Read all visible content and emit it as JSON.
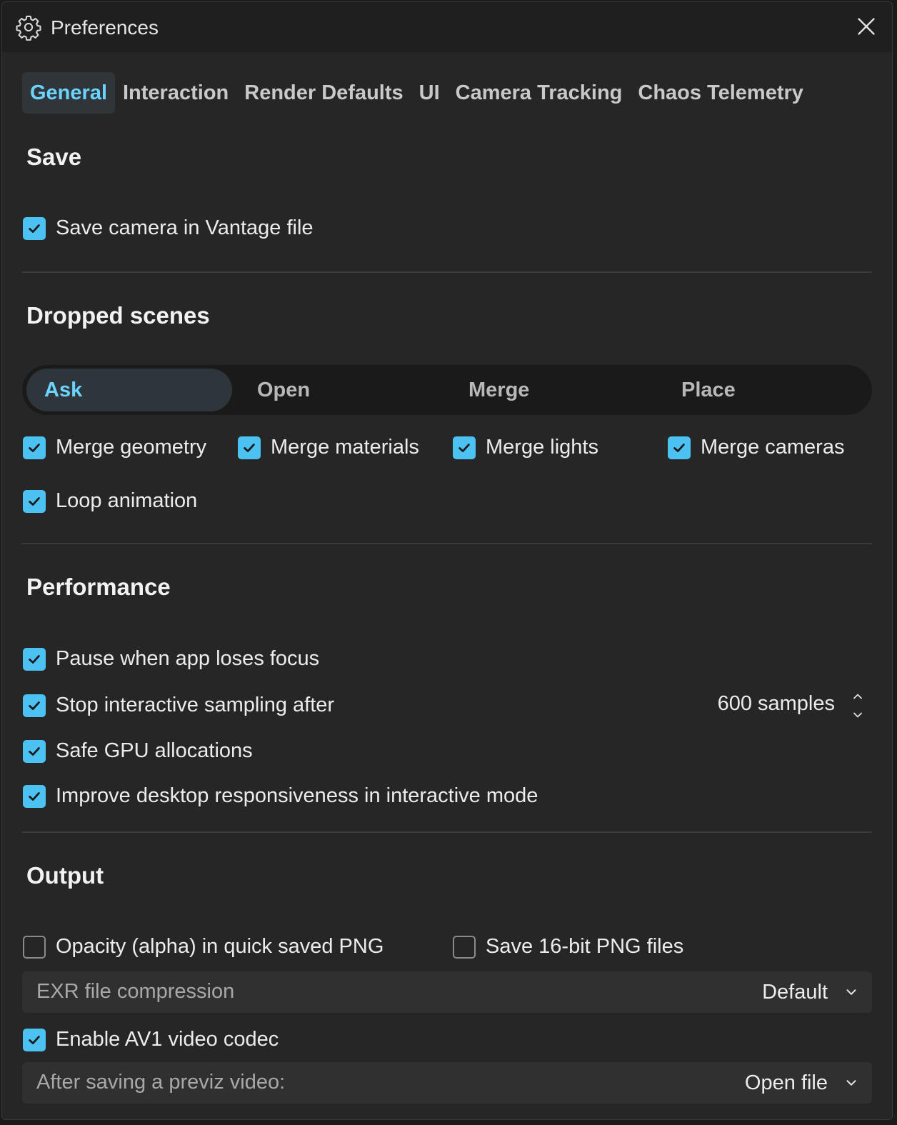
{
  "window": {
    "title": "Preferences",
    "icons": {
      "title": "gear-icon",
      "close": "close-icon"
    }
  },
  "tabs": [
    {
      "label": "General",
      "active": true
    },
    {
      "label": "Interaction",
      "active": false
    },
    {
      "label": "Render Defaults",
      "active": false
    },
    {
      "label": "UI",
      "active": false
    },
    {
      "label": "Camera Tracking",
      "active": false
    },
    {
      "label": "Chaos Telemetry",
      "active": false
    }
  ],
  "save": {
    "title": "Save",
    "save_camera": {
      "label": "Save camera in Vantage file",
      "checked": true
    }
  },
  "dropped_scenes": {
    "title": "Dropped scenes",
    "options": [
      {
        "label": "Ask",
        "active": true
      },
      {
        "label": "Open",
        "active": false
      },
      {
        "label": "Merge",
        "active": false
      },
      {
        "label": "Place",
        "active": false
      }
    ],
    "merge_geometry": {
      "label": "Merge geometry",
      "checked": true
    },
    "merge_materials": {
      "label": "Merge materials",
      "checked": true
    },
    "merge_lights": {
      "label": "Merge lights",
      "checked": true
    },
    "merge_cameras": {
      "label": "Merge cameras",
      "checked": true
    },
    "loop_animation": {
      "label": "Loop animation",
      "checked": true
    }
  },
  "performance": {
    "title": "Performance",
    "pause_focus": {
      "label": "Pause when app loses focus",
      "checked": true
    },
    "stop_sampling": {
      "label": "Stop interactive sampling after",
      "checked": true,
      "value": "600 samples"
    },
    "safe_gpu": {
      "label": "Safe GPU allocations",
      "checked": true
    },
    "improve_desktop": {
      "label": "Improve desktop responsiveness in interactive mode",
      "checked": true
    }
  },
  "output": {
    "title": "Output",
    "opacity_png": {
      "label": "Opacity (alpha) in quick saved PNG",
      "checked": false
    },
    "save_16bit": {
      "label": "Save 16-bit PNG files",
      "checked": false
    },
    "exr_compression": {
      "label": "EXR file compression",
      "value": "Default"
    },
    "enable_av1": {
      "label": "Enable AV1 video codec",
      "checked": true
    },
    "after_previz": {
      "label": "After saving a previz video:",
      "value": "Open file"
    }
  },
  "colors": {
    "accent": "#4cc2f3",
    "tab_active_text": "#6cd3ff",
    "background": "#262626",
    "titlebar": "#1f1f1f"
  }
}
